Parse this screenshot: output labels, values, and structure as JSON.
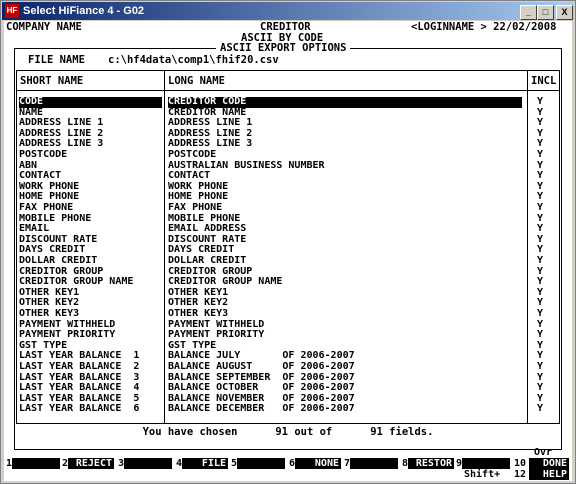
{
  "window": {
    "title": "Select HiFiance 4 - G02",
    "min": "_",
    "max": "□",
    "close": "X"
  },
  "header": {
    "company": "COMPANY NAME",
    "module": "CREDITOR",
    "login_date": "<LOGINNAME > 22/02/2008",
    "subtitle": "ASCII BY CODE",
    "panel_title": "ASCII EXPORT OPTIONS",
    "file_label": "FILE NAME",
    "file_value": "c:\\hf4data\\comp1\\fhif20.csv"
  },
  "columns": {
    "short": "SHORT NAME",
    "long": "LONG NAME",
    "incl": "INCL"
  },
  "rows": [
    {
      "s": "CODE",
      "l": "CREDITOR CODE",
      "i": "Y"
    },
    {
      "s": "NAME",
      "l": "CREDITOR NAME",
      "i": "Y"
    },
    {
      "s": "ADDRESS LINE 1",
      "l": "ADDRESS LINE 1",
      "i": "Y"
    },
    {
      "s": "ADDRESS LINE 2",
      "l": "ADDRESS LINE 2",
      "i": "Y"
    },
    {
      "s": "ADDRESS LINE 3",
      "l": "ADDRESS LINE 3",
      "i": "Y"
    },
    {
      "s": "POSTCODE",
      "l": "POSTCODE",
      "i": "Y"
    },
    {
      "s": "ABN",
      "l": "AUSTRALIAN BUSINESS NUMBER",
      "i": "Y"
    },
    {
      "s": "CONTACT",
      "l": "CONTACT",
      "i": "Y"
    },
    {
      "s": "WORK PHONE",
      "l": "WORK PHONE",
      "i": "Y"
    },
    {
      "s": "HOME PHONE",
      "l": "HOME PHONE",
      "i": "Y"
    },
    {
      "s": "FAX PHONE",
      "l": "FAX PHONE",
      "i": "Y"
    },
    {
      "s": "MOBILE PHONE",
      "l": "MOBILE PHONE",
      "i": "Y"
    },
    {
      "s": "EMAIL",
      "l": "EMAIL ADDRESS",
      "i": "Y"
    },
    {
      "s": "DISCOUNT RATE",
      "l": "DISCOUNT RATE",
      "i": "Y"
    },
    {
      "s": "DAYS CREDIT",
      "l": "DAYS CREDIT",
      "i": "Y"
    },
    {
      "s": "DOLLAR CREDIT",
      "l": "DOLLAR CREDIT",
      "i": "Y"
    },
    {
      "s": "CREDITOR GROUP",
      "l": "CREDITOR GROUP",
      "i": "Y"
    },
    {
      "s": "CREDITOR GROUP NAME",
      "l": "CREDITOR GROUP NAME",
      "i": "Y"
    },
    {
      "s": "OTHER KEY1",
      "l": "OTHER KEY1",
      "i": "Y"
    },
    {
      "s": "OTHER KEY2",
      "l": "OTHER KEY2",
      "i": "Y"
    },
    {
      "s": "OTHER KEY3",
      "l": "OTHER KEY3",
      "i": "Y"
    },
    {
      "s": "PAYMENT WITHHELD",
      "l": "PAYMENT WITHHELD",
      "i": "Y"
    },
    {
      "s": "PAYMENT PRIORITY",
      "l": "PAYMENT PRIORITY",
      "i": "Y"
    },
    {
      "s": "GST TYPE",
      "l": "GST TYPE",
      "i": "Y"
    },
    {
      "s": "LAST YEAR BALANCE  1",
      "l": "BALANCE JULY       OF 2006-2007",
      "i": "Y"
    },
    {
      "s": "LAST YEAR BALANCE  2",
      "l": "BALANCE AUGUST     OF 2006-2007",
      "i": "Y"
    },
    {
      "s": "LAST YEAR BALANCE  3",
      "l": "BALANCE SEPTEMBER  OF 2006-2007",
      "i": "Y"
    },
    {
      "s": "LAST YEAR BALANCE  4",
      "l": "BALANCE OCTOBER    OF 2006-2007",
      "i": "Y"
    },
    {
      "s": "LAST YEAR BALANCE  5",
      "l": "BALANCE NOVEMBER   OF 2006-2007",
      "i": "Y"
    },
    {
      "s": "LAST YEAR BALANCE  6",
      "l": "BALANCE DECEMBER   OF 2006-2007",
      "i": "Y"
    }
  ],
  "status": {
    "prefix": "You have chosen",
    "chosen": "91",
    "mid": "out of",
    "total": "91",
    "suffix": "fields."
  },
  "fkeys": {
    "ovr": "Ovr",
    "shift": "Shift+",
    "n1": "1",
    "n2": "2",
    "l2": "REJECT",
    "n3": "3",
    "n4": "4",
    "l4": "FILE",
    "n5": "5",
    "n6": "6",
    "l6": "NONE",
    "n7": "7",
    "n8": "8",
    "l8": "RESTOR",
    "n9": "9",
    "n10": "10",
    "l10": "DONE",
    "n12": "12",
    "l12": "HELP"
  }
}
